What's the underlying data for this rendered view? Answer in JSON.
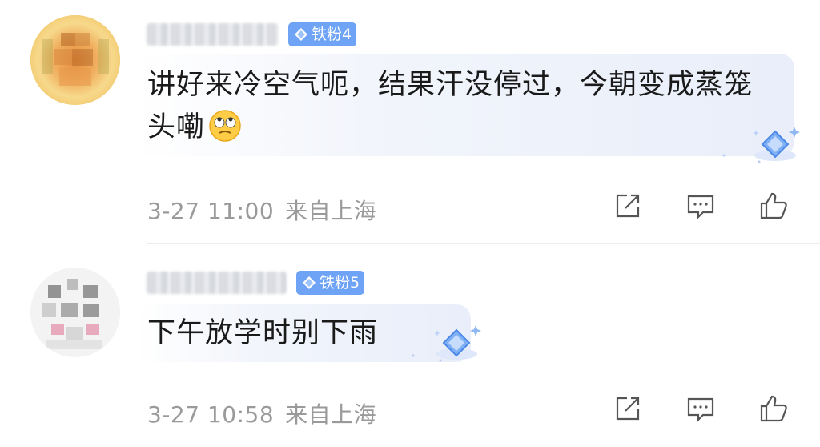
{
  "comments": [
    {
      "badge": "铁粉4",
      "text": "讲好来冷空气呃，结果汗没停过，今朝变成蒸笼头嘞",
      "emoji": "eye-roll-emoji-icon",
      "time": "3-27 11:00",
      "location": "来自上海"
    },
    {
      "badge": "铁粉5",
      "text": "下午放学时别下雨",
      "time": "3-27 10:58",
      "location": "来自上海"
    }
  ],
  "icons": [
    "diamond-badge-icon",
    "share-icon",
    "comment-icon",
    "like-icon",
    "diamond-decoration-icon"
  ],
  "colors": {
    "badge": "#6ea3f5",
    "meta": "#9a9a9a",
    "text": "#1a1a1a",
    "bubble": "#e9eefa"
  }
}
